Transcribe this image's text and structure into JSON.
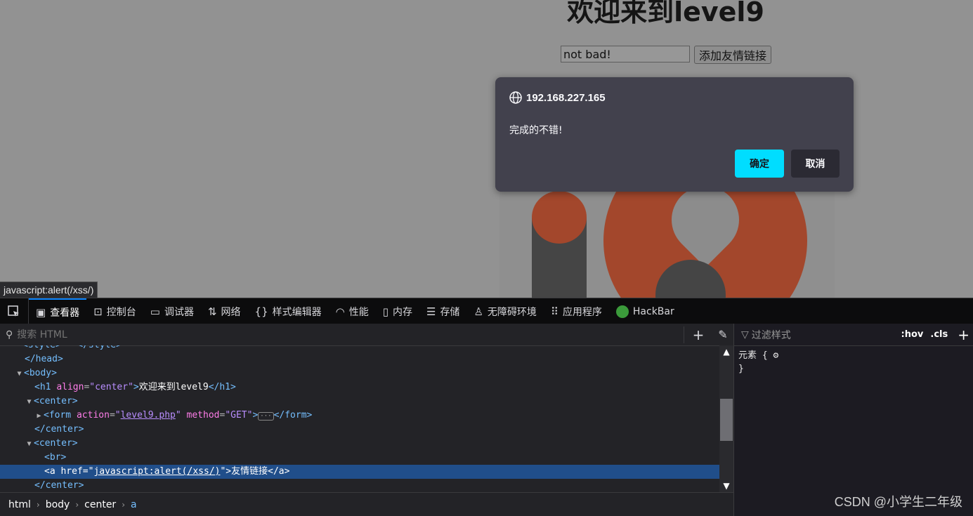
{
  "page": {
    "heading": "欢迎来到level9",
    "input_value": "not bad!",
    "submit_label": "添加友情链接",
    "status_url": "javascript:alert(/xss/)"
  },
  "dialog": {
    "host": "192.168.227.165",
    "message": "完成的不错!",
    "ok_label": "确定",
    "cancel_label": "取消"
  },
  "devtools": {
    "tabs": [
      {
        "label": "查看器",
        "icon": "inspector-icon"
      },
      {
        "label": "控制台",
        "icon": "console-icon"
      },
      {
        "label": "调试器",
        "icon": "debugger-icon"
      },
      {
        "label": "网络",
        "icon": "network-icon"
      },
      {
        "label": "样式编辑器",
        "icon": "style-editor-icon"
      },
      {
        "label": "性能",
        "icon": "performance-icon"
      },
      {
        "label": "内存",
        "icon": "memory-icon"
      },
      {
        "label": "存储",
        "icon": "storage-icon"
      },
      {
        "label": "无障碍环境",
        "icon": "accessibility-icon"
      },
      {
        "label": "应用程序",
        "icon": "application-icon"
      },
      {
        "label": "HackBar",
        "icon": "hackbar-icon"
      }
    ],
    "search_placeholder": "搜索 HTML",
    "filter_placeholder": "过滤样式",
    "hov": ":hov",
    "cls": ".cls",
    "rule_selector": "元素 {",
    "rule_close": "}",
    "breadcrumb": [
      "html",
      "body",
      "center",
      "a"
    ]
  },
  "watermark": "CSDN @小学生二年级"
}
